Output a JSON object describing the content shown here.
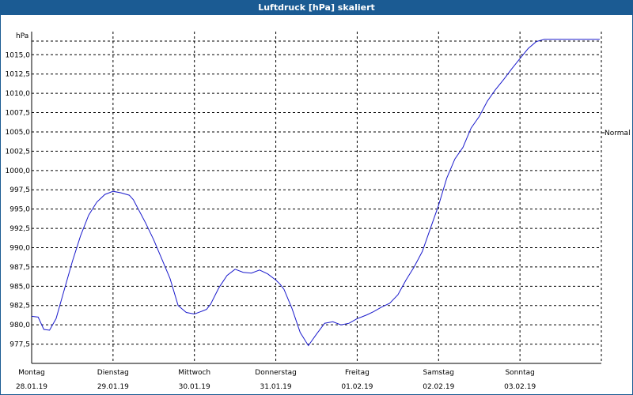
{
  "window": {
    "title": "Luftdruck [hPa] skaliert"
  },
  "chart_data": {
    "type": "line",
    "title": "Luftdruck [hPa] skaliert",
    "ylabel": "hPa",
    "xlabel": "",
    "ylim": [
      975.0,
      1018.0
    ],
    "y_ticks": [
      "977,5",
      "980,0",
      "982,5",
      "985,0",
      "987,5",
      "990,0",
      "992,5",
      "995,0",
      "997,5",
      "1000,0",
      "1002,5",
      "1005,0",
      "1007,5",
      "1010,0",
      "1012,5",
      "1015,0"
    ],
    "y_tick_values": [
      977.5,
      980.0,
      982.5,
      985.0,
      987.5,
      990.0,
      992.5,
      995.0,
      997.5,
      1000.0,
      1002.5,
      1005.0,
      1007.5,
      1010.0,
      1012.5,
      1015.0
    ],
    "x_ticks": [
      {
        "day": "Montag",
        "date": "28.01.19"
      },
      {
        "day": "Dienstag",
        "date": "29.01.19"
      },
      {
        "day": "Mittwoch",
        "date": "30.01.19"
      },
      {
        "day": "Donnerstag",
        "date": "31.01.19"
      },
      {
        "day": "Freitag",
        "date": "01.02.19"
      },
      {
        "day": "Samstag",
        "date": "02.02.19"
      },
      {
        "day": "Sonntag",
        "date": "03.02.19"
      }
    ],
    "xlim": [
      0,
      7
    ],
    "reference_line": {
      "label": "Normal",
      "value": 1004.9
    },
    "series": [
      {
        "color": "#1a1acc",
        "x": [
          0.0,
          0.08,
          0.15,
          0.22,
          0.3,
          0.4,
          0.5,
          0.6,
          0.7,
          0.8,
          0.9,
          1.0,
          1.1,
          1.2,
          1.25,
          1.3,
          1.35,
          1.4,
          1.5,
          1.6,
          1.7,
          1.8,
          1.9,
          2.0,
          2.1,
          2.15,
          2.2,
          2.3,
          2.4,
          2.5,
          2.6,
          2.7,
          2.8,
          2.9,
          3.0,
          3.05,
          3.1,
          3.2,
          3.3,
          3.4,
          3.5,
          3.6,
          3.7,
          3.8,
          3.9,
          4.0,
          4.05,
          4.12,
          4.2,
          4.3,
          4.4,
          4.5,
          4.6,
          4.7,
          4.8,
          4.9,
          5.0,
          5.1,
          5.2,
          5.3,
          5.4,
          5.5,
          5.6,
          5.7,
          5.8,
          5.9,
          6.0,
          6.1,
          6.2,
          6.3,
          6.4,
          6.5,
          6.6,
          6.7,
          6.8,
          6.9,
          6.98
        ],
        "values": [
          981.1,
          981.0,
          979.4,
          979.3,
          980.8,
          984.5,
          988.2,
          991.5,
          994.2,
          995.9,
          996.9,
          997.3,
          997.1,
          996.8,
          996.2,
          995.2,
          994.2,
          993.2,
          991.0,
          988.5,
          986.0,
          982.5,
          981.6,
          981.4,
          981.8,
          982.0,
          982.7,
          984.8,
          986.4,
          987.2,
          986.8,
          986.7,
          987.1,
          986.6,
          985.8,
          985.3,
          984.6,
          982.1,
          979.0,
          977.3,
          978.8,
          980.2,
          980.4,
          980.0,
          980.2,
          980.8,
          981.0,
          981.3,
          981.7,
          982.3,
          982.8,
          983.9,
          985.8,
          987.5,
          989.5,
          992.5,
          995.5,
          999.0,
          1001.5,
          1003.0,
          1005.5,
          1007.0,
          1009.0,
          1010.5,
          1011.8,
          1013.2,
          1014.5,
          1015.8,
          1016.7,
          1017.0,
          1017.0,
          1017.0,
          1017.0,
          1017.0,
          1017.0,
          1017.0,
          1017.0
        ]
      }
    ]
  }
}
